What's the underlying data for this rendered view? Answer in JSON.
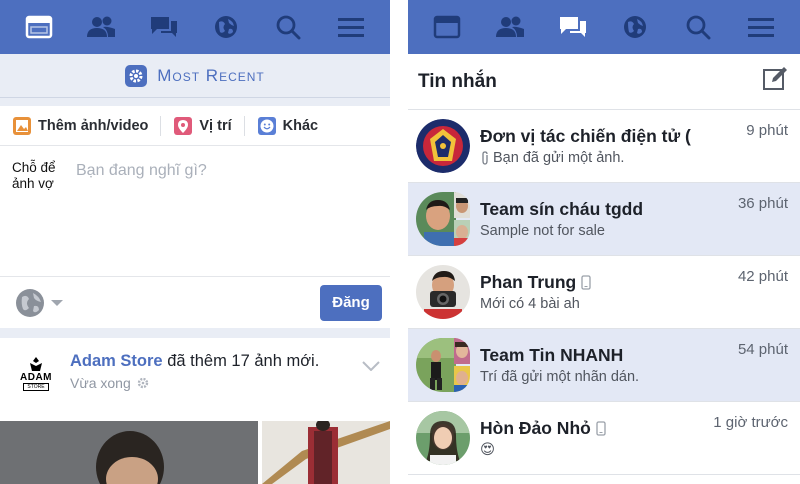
{
  "left": {
    "most_recent_label": "Most Recent",
    "composer": {
      "actions": [
        {
          "label": "Thêm ảnh/video",
          "icon": "photo-icon",
          "color": "#e8913a"
        },
        {
          "label": "Vị trí",
          "icon": "location-pin-icon",
          "color": "#e05a7a"
        },
        {
          "label": "Khác",
          "icon": "smiley-icon",
          "color": "#5a7fd6"
        }
      ],
      "avatar_alt": "Chỗ để ảnh vợ",
      "placeholder": "Bạn đang nghĩ gì?",
      "post_label": "Đăng"
    },
    "story": {
      "page_name": "Adam Store",
      "action_text": "đã thêm 17 ảnh mới.",
      "time": "Vừa xong",
      "logo_text": "ADAM",
      "logo_sub": "STORE"
    }
  },
  "right": {
    "title": "Tin nhắn",
    "threads": [
      {
        "name": "Đơn vị tác chiến điện tử (",
        "preview": "Bạn đã gửi một ảnh.",
        "time": "9 phút",
        "unread": false
      },
      {
        "name": "Team sín cháu tgdd",
        "preview": "Sample not for sale",
        "time": "36 phút",
        "unread": true
      },
      {
        "name": "Phan Trung",
        "preview": "Mới có 4 bài ah",
        "time": "42 phút",
        "unread": false
      },
      {
        "name": "Team Tin NHANH",
        "preview": "Trí đã gửi một nhãn dán.",
        "time": "54 phút",
        "unread": true
      },
      {
        "name": "Hòn Đảo Nhỏ",
        "preview": "😍",
        "time": "1 giờ trước",
        "unread": false
      }
    ]
  },
  "colors": {
    "brand_blue": "#4d6fbf",
    "unread_bg": "#e3e8f5"
  }
}
